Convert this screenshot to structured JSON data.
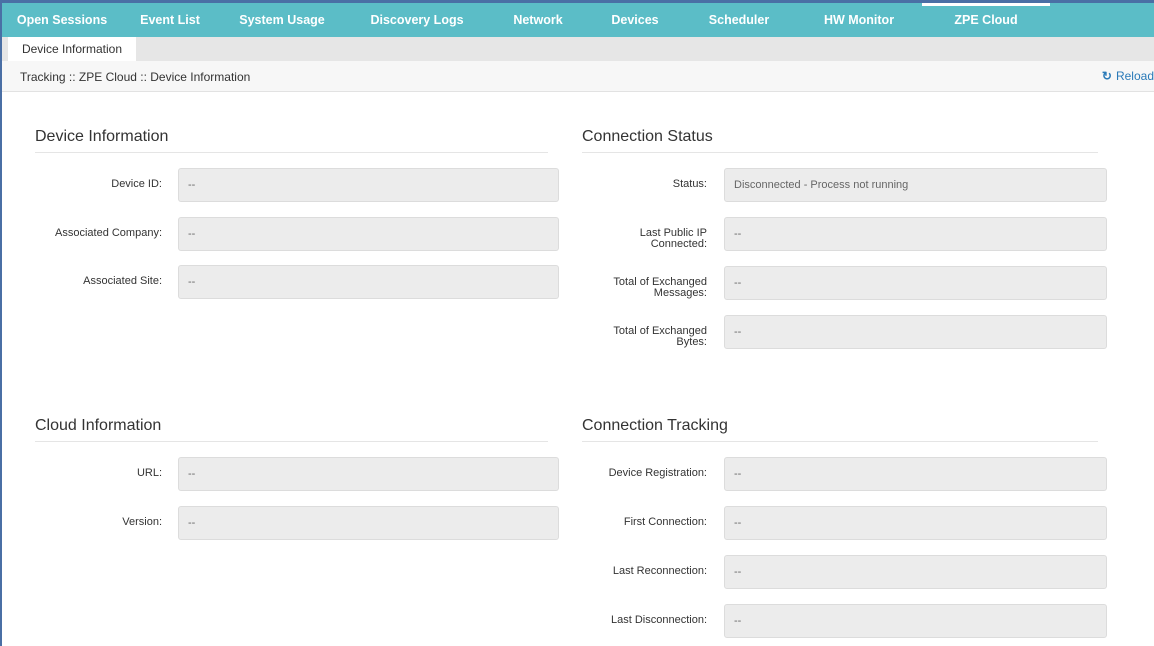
{
  "top_tabs": [
    "Open Sessions",
    "Event List",
    "System Usage",
    "Discovery Logs",
    "Network",
    "Devices",
    "Scheduler",
    "HW Monitor",
    "ZPE Cloud"
  ],
  "active_tab": "ZPE Cloud",
  "sub_tab": "Device Information",
  "breadcrumb": "Tracking :: ZPE Cloud :: Device Information",
  "reload_label": "Reload",
  "icons": {
    "reload": "refresh-icon"
  },
  "colors": {
    "nav_bg": "#5bbdc7",
    "link": "#2a7ab8",
    "field_bg": "#ececec"
  },
  "device_info": {
    "title": "Device Information",
    "device_id": {
      "label": "Device ID:",
      "value": "--"
    },
    "company": {
      "label": "Associated Company:",
      "value": "--"
    },
    "site": {
      "label": "Associated Site:",
      "value": "--"
    }
  },
  "connection_status": {
    "title": "Connection Status",
    "status": {
      "label": "Status:",
      "value": "Disconnected - Process not running"
    },
    "last_ip": {
      "label_l1": "Last Public IP",
      "label_l2": "Connected:",
      "value": "--"
    },
    "messages": {
      "label_l1": "Total of Exchanged",
      "label_l2": "Messages:",
      "value": "--"
    },
    "bytes": {
      "label_l1": "Total of Exchanged",
      "label_l2": "Bytes:",
      "value": "--"
    }
  },
  "cloud_info": {
    "title": "Cloud Information",
    "url": {
      "label": "URL:",
      "value": "--"
    },
    "version": {
      "label": "Version:",
      "value": "--"
    }
  },
  "connection_tracking": {
    "title": "Connection Tracking",
    "registration": {
      "label": "Device Registration:",
      "value": "--"
    },
    "first": {
      "label": "First Connection:",
      "value": "--"
    },
    "reconnection": {
      "label": "Last Reconnection:",
      "value": "--"
    },
    "disconnection": {
      "label": "Last Disconnection:",
      "value": "--"
    }
  }
}
